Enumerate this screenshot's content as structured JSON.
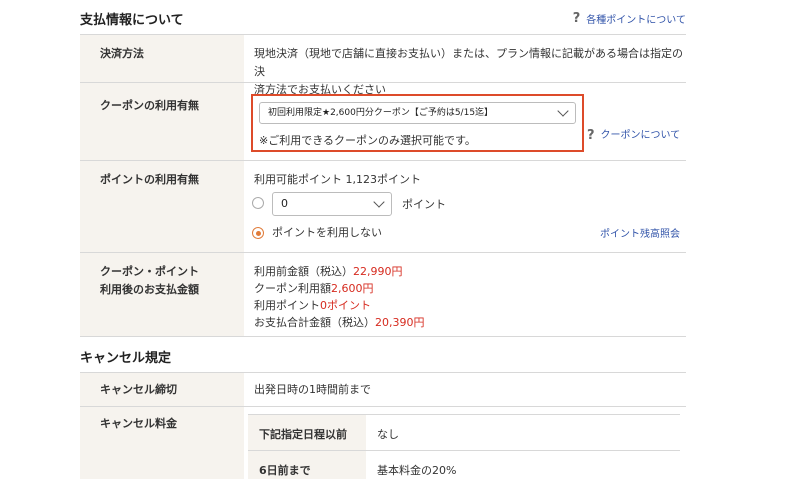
{
  "payment": {
    "title": "支払情報について",
    "help_link": "各種ポイントについて",
    "method_label": "決済方法",
    "method_text_1": "現地決済（現地で店舗に直接お支払い）または、プラン情報に記載がある場合は指定の決",
    "method_text_2": "済方法でお支払いください",
    "coupon_label": "クーポンの利用有無",
    "coupon_selected": "初回利用限定★2,600円分クーポン【ご予約は5/15迄】",
    "coupon_note": "※ご利用できるクーポンのみ選択可能です。",
    "coupon_help": "クーポンについて",
    "points_label": "ポイントの利用有無",
    "points_available": "利用可能ポイント 1,123ポイント",
    "points_select_value": "0",
    "points_unit": "ポイント",
    "points_no_use": "ポイントを利用しない",
    "points_balance_link": "ポイント残高照会",
    "summary_label_1": "クーポン・ポイント",
    "summary_label_2": "利用後のお支払金額",
    "pre_total_label": "利用前金額（税込）",
    "pre_total_value": "22,990円",
    "coupon_amount_label": "クーポン利用額",
    "coupon_amount_value": "2,600円",
    "points_used_label": "利用ポイント",
    "points_used_value": "0ポイント",
    "total_label": "お支払合計金額（税込）",
    "total_value": "20,390円"
  },
  "cancel": {
    "title": "キャンセル規定",
    "deadline_label": "キャンセル締切",
    "deadline_value": "出発日時の1時間前まで",
    "fee_label": "キャンセル料金",
    "fee_rows": [
      {
        "label": "下記指定日程以前",
        "value": "なし"
      },
      {
        "label": "6日前まで",
        "value": "基本料金の20%"
      }
    ]
  },
  "colors": {
    "highlight_border": "#dd4b2a",
    "price_red": "#d62b1f",
    "link_blue": "#3355aa",
    "label_bg": "#f6f3ee",
    "radio_orange": "#e07b39"
  }
}
